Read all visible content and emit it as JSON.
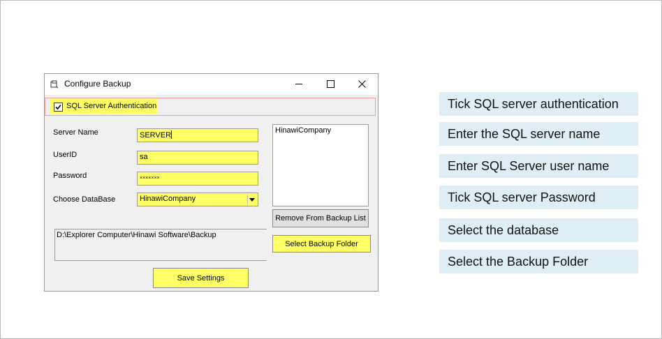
{
  "dialog": {
    "title": "Configure Backup",
    "sql_auth_label": "SQL Server Authentication",
    "sql_auth_checked": true,
    "server_name_label": "Server Name",
    "server_name_value": "SERVER",
    "userid_label": "UserID",
    "userid_value": "sa",
    "password_label": "Password",
    "password_value": "×××××××",
    "database_label": "Choose DataBase",
    "database_value": "HinawiCompany",
    "backup_path": "D:\\Explorer Computer\\Hinawi Software\\Backup",
    "backup_list_items": [
      "HinawiCompany"
    ],
    "remove_button": "Remove From Backup List",
    "select_folder_button": "Select Backup Folder",
    "save_button": "Save Settings"
  },
  "steps": [
    "Tick SQL server authentication",
    "Enter the SQL server name",
    "Enter SQL Server user name",
    "Tick SQL server Password",
    "Select the database",
    "Select the Backup Folder"
  ],
  "colors": {
    "highlight": "#ffff66",
    "card": "#dfeef4",
    "auth_border": "#f2a0a0"
  }
}
